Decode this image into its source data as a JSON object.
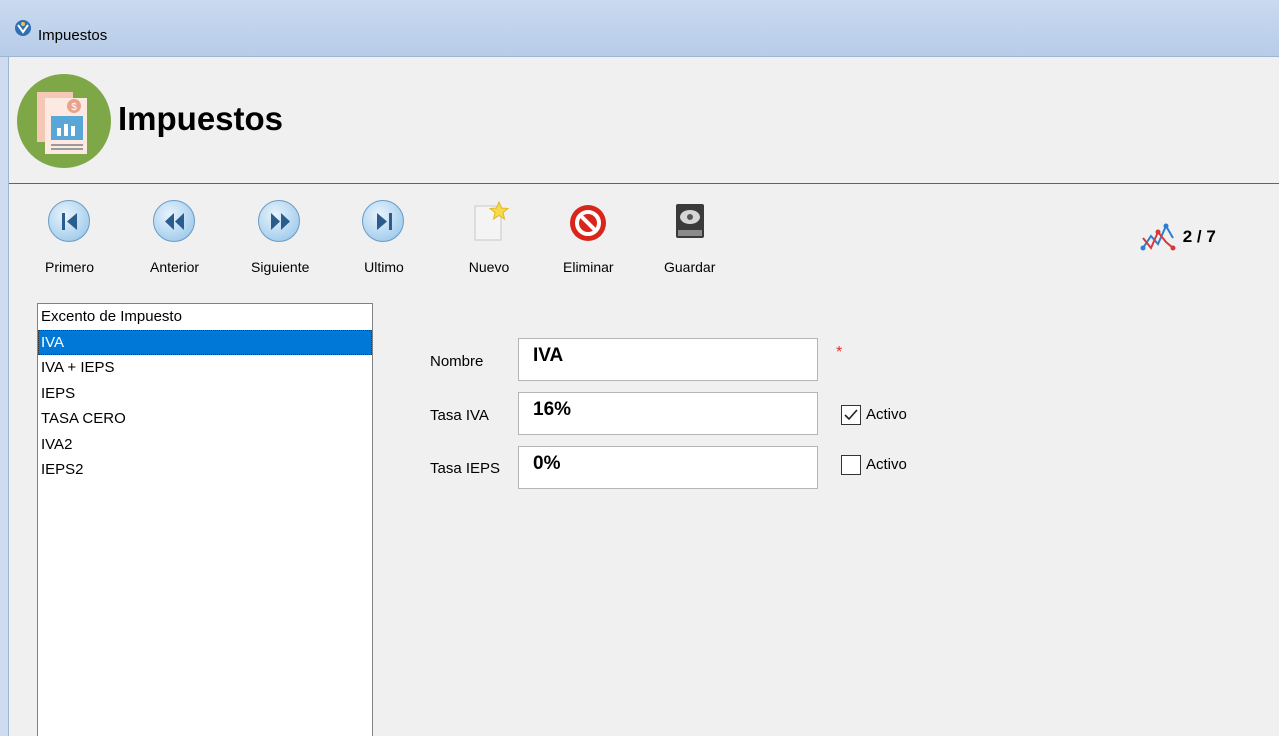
{
  "window": {
    "title": "Impuestos"
  },
  "header": {
    "title": "Impuestos"
  },
  "toolbar": {
    "first": "Primero",
    "prev": "Anterior",
    "next": "Siguiente",
    "last": "Ultimo",
    "new": "Nuevo",
    "delete": "Eliminar",
    "save": "Guardar"
  },
  "record_counter": "2 / 7",
  "list": {
    "items": [
      "Excento de Impuesto",
      "IVA",
      "IVA + IEPS",
      "IEPS",
      "TASA CERO",
      "IVA2",
      "IEPS2"
    ],
    "selected_index": 1
  },
  "form": {
    "nombre": {
      "label": "Nombre",
      "value": "IVA",
      "required_mark": "*"
    },
    "tasa_iva": {
      "label": "Tasa IVA",
      "value": "16%",
      "activo_label": "Activo",
      "activo_checked": true
    },
    "tasa_ieps": {
      "label": "Tasa IEPS",
      "value": "0%",
      "activo_label": "Activo",
      "activo_checked": false
    }
  },
  "colors": {
    "selection": "#0078d7",
    "header_line": "#c23a3a",
    "required": "#e03030",
    "logo_circle": "#7ea847"
  }
}
